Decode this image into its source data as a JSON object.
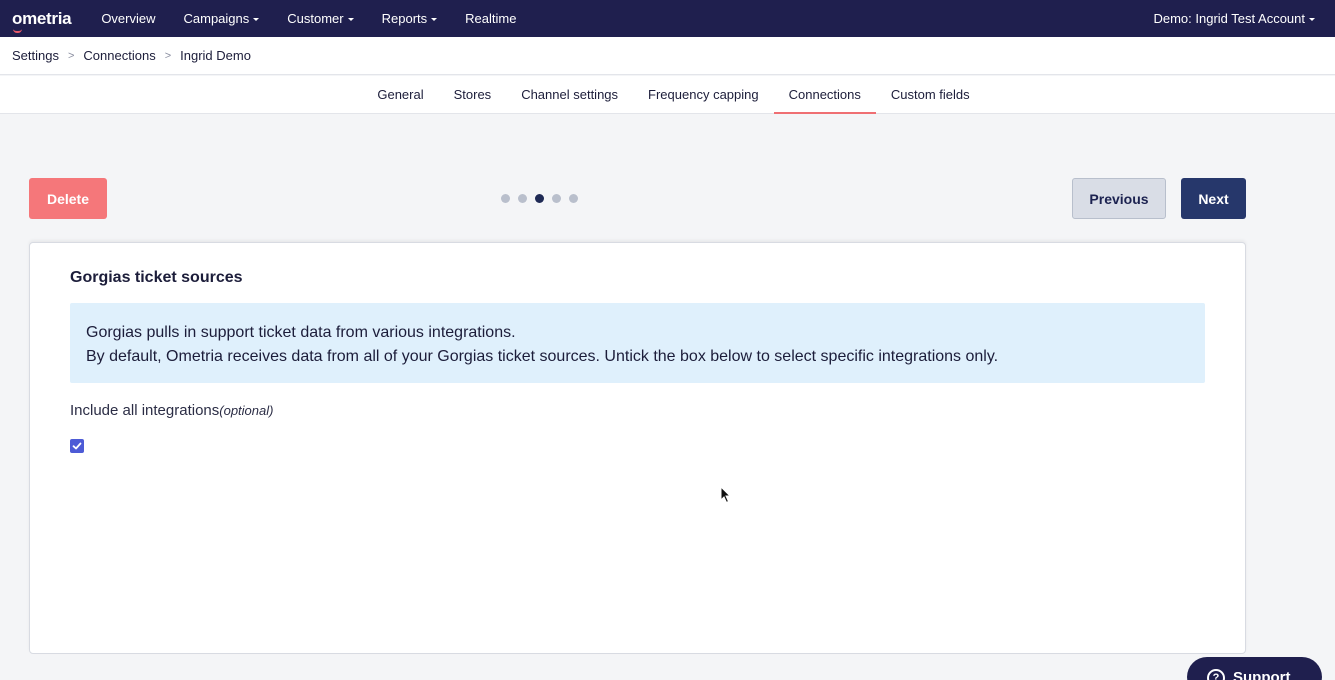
{
  "topbar": {
    "logo": "ometria",
    "nav": [
      {
        "label": "Overview",
        "dropdown": false
      },
      {
        "label": "Campaigns",
        "dropdown": true
      },
      {
        "label": "Customer",
        "dropdown": true
      },
      {
        "label": "Reports",
        "dropdown": true
      },
      {
        "label": "Realtime",
        "dropdown": false
      }
    ],
    "account": "Demo: Ingrid Test Account"
  },
  "breadcrumb": [
    "Settings",
    "Connections",
    "Ingrid Demo"
  ],
  "breadcrumb_separator": ">",
  "tabs": [
    {
      "label": "General",
      "active": false
    },
    {
      "label": "Stores",
      "active": false
    },
    {
      "label": "Channel settings",
      "active": false
    },
    {
      "label": "Frequency capping",
      "active": false
    },
    {
      "label": "Connections",
      "active": true
    },
    {
      "label": "Custom fields",
      "active": false
    }
  ],
  "actions": {
    "delete_label": "Delete",
    "previous_label": "Previous",
    "next_label": "Next"
  },
  "stepper": {
    "total": 5,
    "current": 3
  },
  "card": {
    "title": "Gorgias ticket sources",
    "info_line1": "Gorgias pulls in support ticket data from various integrations.",
    "info_line2": "By default, Ometria receives data from all of your Gorgias ticket sources. Untick the box below to select specific integrations only.",
    "field_label": "Include all integrations",
    "field_optional": "(optional)",
    "checked": true
  },
  "support": {
    "label": "Support",
    "icon": "question-icon"
  },
  "colors": {
    "topbar": "#1f1f4e",
    "delete": "#f5777a",
    "next": "#26376b",
    "tab_active_underline": "#ef6f73",
    "info_bg": "#dff0fc",
    "checkbox": "#4d5bd6"
  }
}
